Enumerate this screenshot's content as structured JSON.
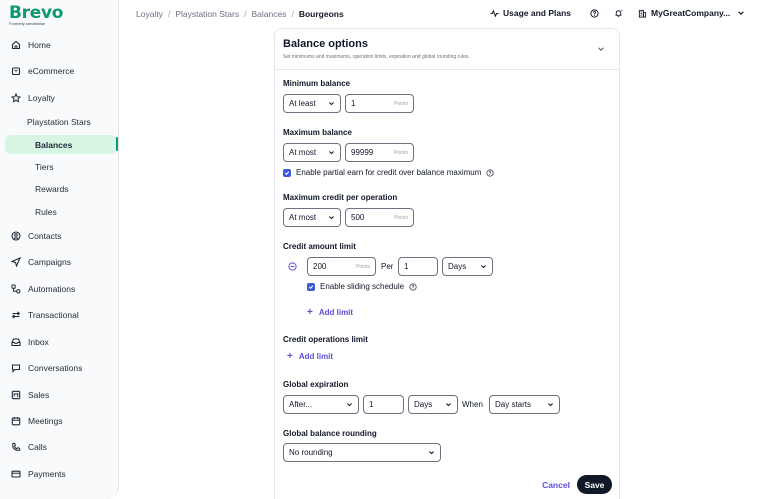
{
  "brand": {
    "name": "Brevo",
    "formerly": "Formerly sendinblue",
    "color": "#0b996e"
  },
  "sidebar": {
    "items": [
      {
        "label": "Home",
        "icon": "home-icon"
      },
      {
        "label": "eCommerce",
        "icon": "ecommerce-icon"
      },
      {
        "label": "Loyalty",
        "icon": "star-icon"
      },
      {
        "label": "Contacts",
        "icon": "contacts-icon"
      },
      {
        "label": "Campaigns",
        "icon": "send-icon"
      },
      {
        "label": "Automations",
        "icon": "automation-icon"
      },
      {
        "label": "Transactional",
        "icon": "transactional-icon"
      },
      {
        "label": "Inbox",
        "icon": "inbox-icon"
      },
      {
        "label": "Conversations",
        "icon": "chat-icon"
      },
      {
        "label": "Sales",
        "icon": "sales-icon"
      },
      {
        "label": "Meetings",
        "icon": "calendar-icon"
      },
      {
        "label": "Calls",
        "icon": "phone-icon"
      },
      {
        "label": "Payments",
        "icon": "card-icon"
      }
    ],
    "loyalty_sub": {
      "program": "Playstation Stars",
      "items": [
        "Balances",
        "Tiers",
        "Rewards",
        "Rules"
      ],
      "active": "Balances"
    }
  },
  "breadcrumb": [
    "Loyalty",
    "Playstation Stars",
    "Balances",
    "Bourgeons"
  ],
  "topbar": {
    "usage": "Usage and Plans",
    "company": "MyGreatCompany..."
  },
  "panel": {
    "title": "Balance options",
    "description": "Set minimums and maximums, operation limits, expiration and global rounding rules.",
    "min_balance": {
      "label": "Minimum balance",
      "operator": "At least",
      "value": "1",
      "unit": "Points"
    },
    "max_balance": {
      "label": "Maximum balance",
      "operator": "At most",
      "value": "99999",
      "unit": "Points",
      "partial_label": "Enable partial earn for credit over balance maximum"
    },
    "max_credit": {
      "label": "Maximum credit per operation",
      "operator": "At most",
      "value": "500",
      "unit": "Points"
    },
    "credit_amount": {
      "label": "Credit amount limit",
      "value": "200",
      "unit": "Points",
      "per": "Per",
      "period_value": "1",
      "period_unit": "Days",
      "sliding_label": "Enable sliding schedule",
      "add_label": "Add limit"
    },
    "credit_ops": {
      "label": "Credit operations limit",
      "add_label": "Add limit"
    },
    "expiration": {
      "label": "Global expiration",
      "operator": "After...",
      "value": "1",
      "unit": "Days",
      "when": "When",
      "trigger": "Day starts"
    },
    "rounding": {
      "label": "Global balance rounding",
      "value": "No rounding"
    },
    "cancel": "Cancel",
    "save": "Save"
  }
}
